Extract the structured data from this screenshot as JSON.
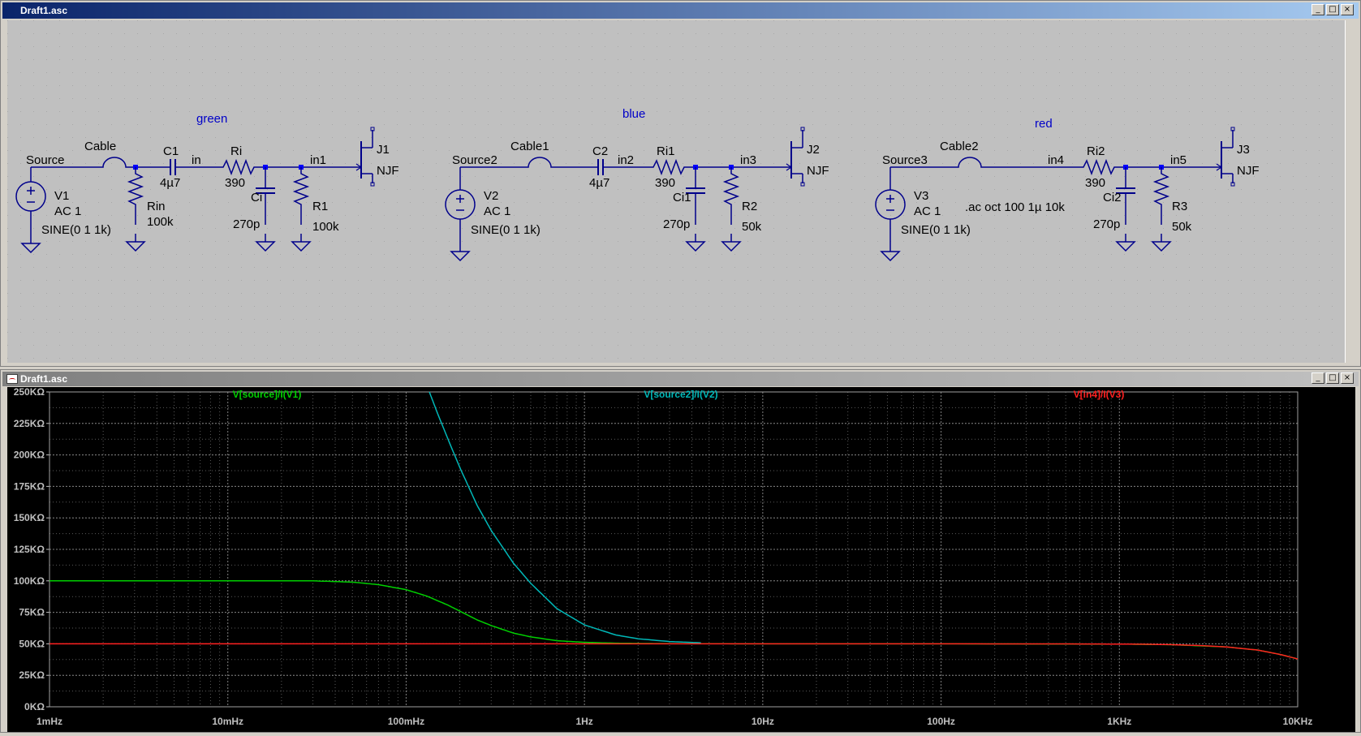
{
  "schematic_window": {
    "title": "Draft1.asc",
    "buttons": {
      "minimize": "_",
      "restore": "□",
      "close": "×"
    },
    "circuits": [
      {
        "color_label": "green",
        "source_net": "Source",
        "cable": "Cable",
        "vsrc_name": "V1",
        "vsrc_ac": "AC 1",
        "vsrc_func": "SINE(0 1 1k)",
        "cap_name": "C1",
        "cap_value": "4µ7",
        "node_a": "in",
        "shunt_r_name": "Rin",
        "shunt_r_value": "100k",
        "ri_name": "Ri",
        "ri_value": "390",
        "ci_name": "Ci",
        "ci_value": "270p",
        "node_b": "in1",
        "rload_name": "R1",
        "rload_value": "100k",
        "jfet_name": "J1",
        "jfet_model": "NJF"
      },
      {
        "color_label": "blue",
        "source_net": "Source2",
        "cable": "Cable1",
        "vsrc_name": "V2",
        "vsrc_ac": "AC 1",
        "vsrc_func": "SINE(0 1 1k)",
        "cap_name": "C2",
        "cap_value": "4µ7",
        "node_a": "in2",
        "ri_name": "Ri1",
        "ri_value": "390",
        "ci_name": "Ci1",
        "ci_value": "270p",
        "node_b": "in3",
        "rload_name": "R2",
        "rload_value": "50k",
        "jfet_name": "J2",
        "jfet_model": "NJF"
      },
      {
        "color_label": "red",
        "source_net": "Source3",
        "cable": "Cable2",
        "vsrc_name": "V3",
        "vsrc_ac": "AC 1",
        "vsrc_func": "SINE(0 1 1k)",
        "node_a": "in4",
        "ri_name": "Ri2",
        "ri_value": "390",
        "ci_name": "Ci2",
        "ci_value": "270p",
        "node_b": "in5",
        "rload_name": "R3",
        "rload_value": "50k",
        "jfet_name": "J3",
        "jfet_model": "NJF"
      }
    ],
    "directive": ".ac oct 100 1µ 10k",
    "colors": {
      "wire": "#00008b",
      "label": "#0000c8",
      "text": "#000000",
      "junction": "#0000ff"
    }
  },
  "plot_window": {
    "title": "Draft1.asc",
    "buttons": {
      "minimize": "_",
      "restore": "□",
      "close": "×"
    },
    "colors": {
      "background": "#000000",
      "grid": "#5a5a5a",
      "axis_text": "#c0c0c0",
      "green": "#00d000",
      "cyan": "#00b8b8",
      "red": "#ff2020"
    }
  },
  "chart_data": {
    "type": "line",
    "title": "",
    "x_scale": "log",
    "xlim": [
      0.001,
      10000
    ],
    "ylim": [
      0,
      250000
    ],
    "x_ticks": [
      {
        "value": 0.001,
        "label": "1mHz"
      },
      {
        "value": 0.01,
        "label": "10mHz"
      },
      {
        "value": 0.1,
        "label": "100mHz"
      },
      {
        "value": 1,
        "label": "1Hz"
      },
      {
        "value": 10,
        "label": "10Hz"
      },
      {
        "value": 100,
        "label": "100Hz"
      },
      {
        "value": 1000,
        "label": "1KHz"
      },
      {
        "value": 10000,
        "label": "10KHz"
      }
    ],
    "y_ticks": [
      {
        "value": 250000,
        "label": "250KΩ"
      },
      {
        "value": 225000,
        "label": "225KΩ"
      },
      {
        "value": 200000,
        "label": "200KΩ"
      },
      {
        "value": 175000,
        "label": "175KΩ"
      },
      {
        "value": 150000,
        "label": "150KΩ"
      },
      {
        "value": 125000,
        "label": "125KΩ"
      },
      {
        "value": 100000,
        "label": "100KΩ"
      },
      {
        "value": 75000,
        "label": "75KΩ"
      },
      {
        "value": 50000,
        "label": "50KΩ"
      },
      {
        "value": 25000,
        "label": "25KΩ"
      },
      {
        "value": 0,
        "label": "0KΩ"
      }
    ],
    "grid": true,
    "legend_position": "top",
    "series": [
      {
        "name": "V[source]/I(V1)",
        "color": "#00d000",
        "x": [
          0.001,
          0.01,
          0.03,
          0.05,
          0.07,
          0.1,
          0.13,
          0.17,
          0.2,
          0.25,
          0.3,
          0.4,
          0.5,
          0.7,
          1,
          1.5,
          2,
          3,
          5,
          10,
          100,
          1000,
          2000,
          4000,
          6000,
          8000,
          10000
        ],
        "y": [
          100000,
          100000,
          100000,
          99000,
          97000,
          93000,
          88000,
          81000,
          76000,
          69000,
          64500,
          58500,
          55500,
          52500,
          51200,
          50500,
          50300,
          50150,
          50050,
          50000,
          50000,
          49800,
          49300,
          47500,
          45000,
          41500,
          38000
        ]
      },
      {
        "name": "V[source2]/I(V2)",
        "color": "#00b8b8",
        "x": [
          0.135,
          0.15,
          0.17,
          0.2,
          0.25,
          0.3,
          0.4,
          0.5,
          0.7,
          1,
          1.5,
          2,
          3,
          4.5
        ],
        "y": [
          250000,
          233000,
          214000,
          190000,
          160000,
          140000,
          114000,
          98000,
          78000,
          65000,
          57000,
          54000,
          51800,
          50800
        ]
      },
      {
        "name": "V[in4]/I(V3)",
        "color": "#ff2020",
        "x": [
          0.001,
          0.01,
          0.1,
          1,
          10,
          100,
          600,
          1000,
          1500,
          2000,
          3000,
          4000,
          6000,
          8000,
          10000
        ],
        "y": [
          50000,
          50000,
          50000,
          50000,
          50000,
          50000,
          49900,
          49800,
          49600,
          49300,
          48500,
          47500,
          45000,
          41500,
          38000
        ]
      }
    ]
  }
}
